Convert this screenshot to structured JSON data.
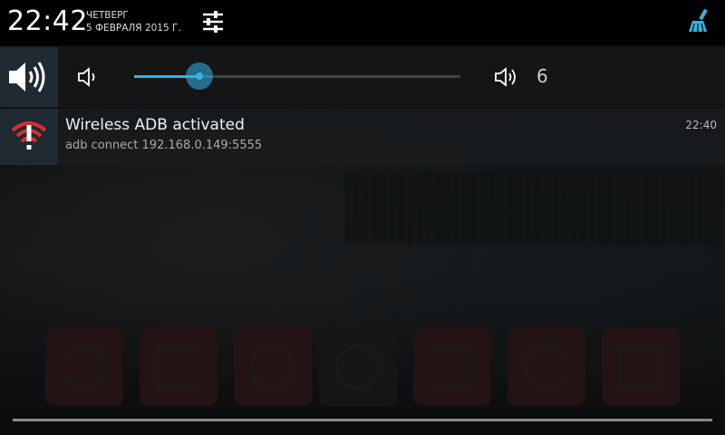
{
  "status_bar": {
    "time": "22:42",
    "day": "ЧЕТВЕРГ",
    "date": "5 ФЕВРАЛЯ 2015 Г.",
    "settings_icon": "sliders-icon",
    "clean_icon": "broom-icon"
  },
  "volume": {
    "level_fraction": 0.2,
    "value": "6",
    "accent_color": "#33b5e5"
  },
  "notification": {
    "title": "Wireless ADB activated",
    "text": "adb connect 192.168.0.149:5555",
    "time": "22:40",
    "icon": "wifi-warning-icon"
  }
}
